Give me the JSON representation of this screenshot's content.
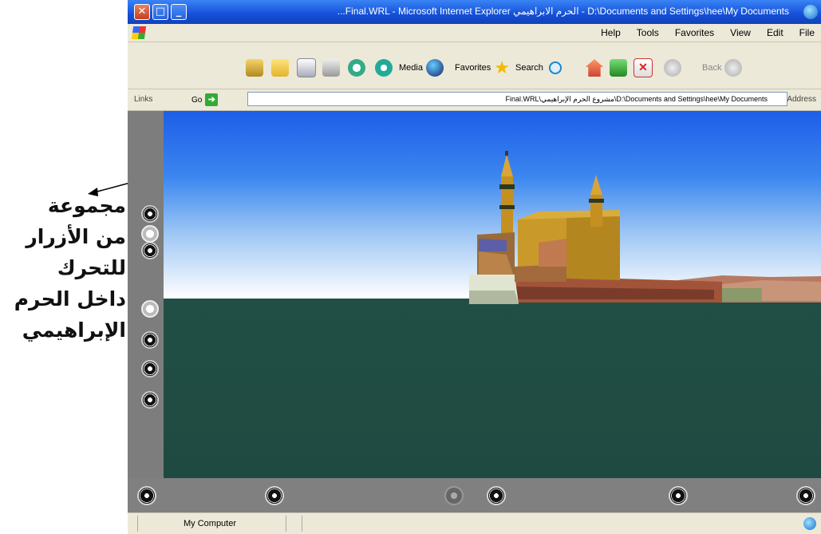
{
  "annotation": {
    "lines": [
      "مجموعة",
      "من الأزرار",
      "للتحرك",
      "داخل الحرم",
      "الإبراهيمي"
    ]
  },
  "window": {
    "title": "...Final.WRL - Microsoft Internet Explorer الحرم الابراهيمي - D:\\Documents and Settings\\hee\\My Documents"
  },
  "menu": [
    "File",
    "Edit",
    "View",
    "Favorites",
    "Tools",
    "Help"
  ],
  "toolbar": {
    "back_label": "Back",
    "search_label": "Search",
    "favorites_label": "Favorites",
    "media_label": "Media"
  },
  "address": {
    "label": "Address",
    "value": "D:\\Documents and Settings\\hee\\My Documents\\مشروع الحرم الإبراهيمي\\Final.WRL",
    "go_label": "Go",
    "links_label": "Links"
  },
  "status": {
    "text": "My Computer",
    "zone": ""
  },
  "colors": {
    "titlebar": "#1450d8",
    "chrome": "#ece9d8",
    "ground": "#214f45",
    "sky_top": "#1e5ee8"
  }
}
